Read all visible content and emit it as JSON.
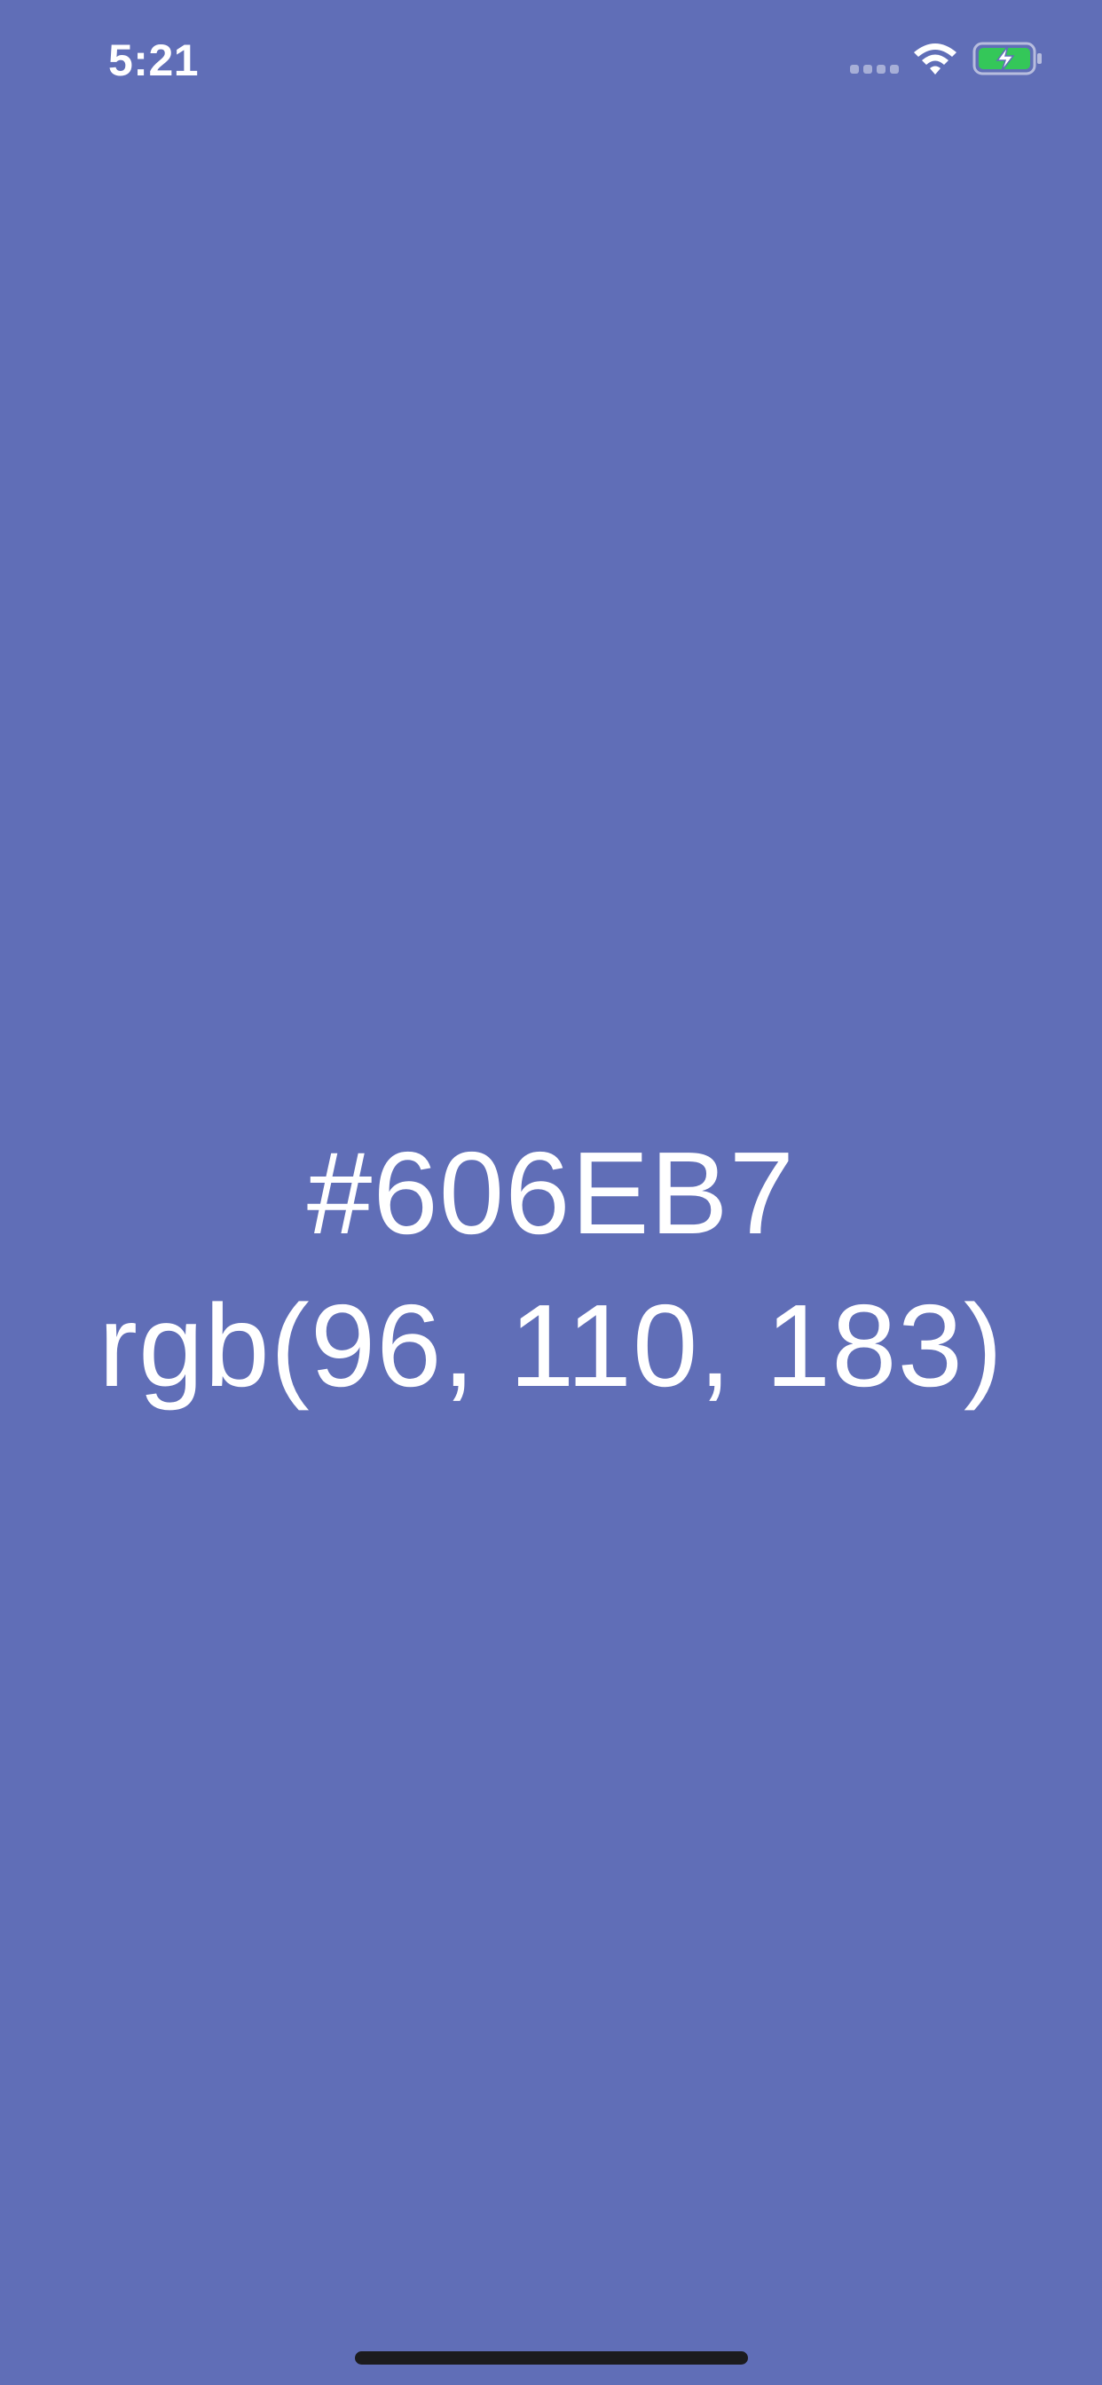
{
  "status_bar": {
    "time": "5:21",
    "signal_icon": "signal-dots-icon",
    "wifi_icon": "wifi-icon",
    "battery_icon": "battery-charging-icon",
    "battery_color": "#34C759"
  },
  "color_display": {
    "hex": "#606EB7",
    "rgb": "rgb(96, 110, 183)",
    "background_color": "#606EB7"
  },
  "home_indicator": {
    "color": "#1c1c1e"
  }
}
